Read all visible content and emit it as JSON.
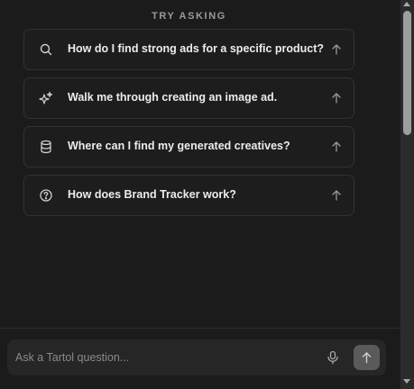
{
  "section": {
    "title": "TRY ASKING"
  },
  "suggestions": [
    {
      "label": "How do I find strong ads for a specific product?",
      "icon": "search-icon"
    },
    {
      "label": "Walk me through creating an image ad.",
      "icon": "sparkles-icon"
    },
    {
      "label": "Where can I find my generated creatives?",
      "icon": "database-icon"
    },
    {
      "label": "How does Brand Tracker work?",
      "icon": "help-circle-icon"
    }
  ],
  "composer": {
    "placeholder": "Ask a Tartol question...",
    "value": ""
  },
  "colors": {
    "background": "#1b1b1b",
    "card_border": "#313131",
    "send_button": "#5a5a5a",
    "text": "#ececec",
    "muted": "#9a9a9a"
  }
}
